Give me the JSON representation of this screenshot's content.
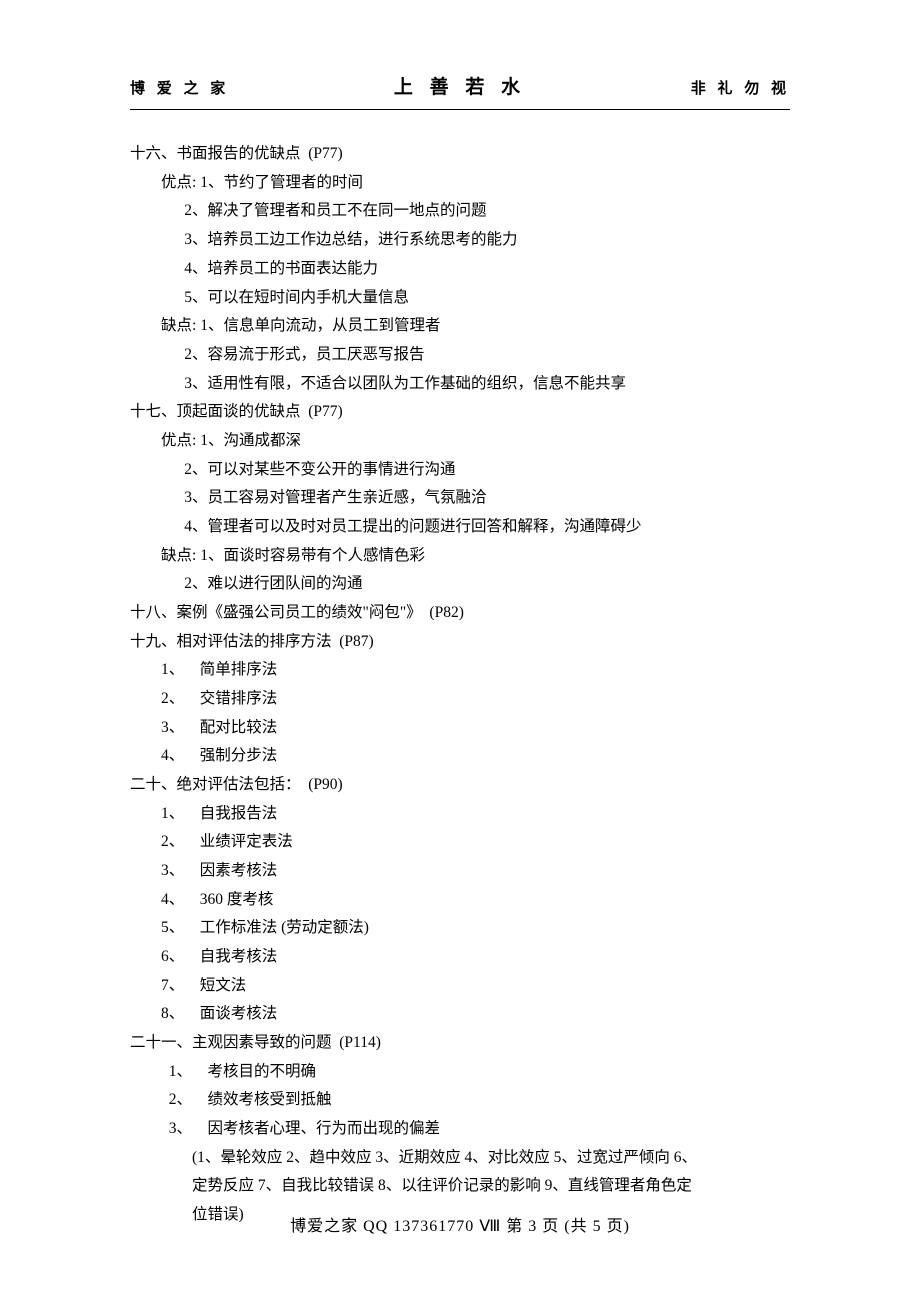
{
  "header": {
    "left": "博 爱 之 家",
    "center": "上 善 若 水",
    "right": "非 礼 勿 视"
  },
  "sections": {
    "s16": {
      "title": "十六、书面报告的优缺点  (P77)",
      "pros_label": "优点:",
      "pros": [
        "1、节约了管理者的时间",
        "2、解决了管理者和员工不在同一地点的问题",
        "3、培养员工边工作边总结，进行系统思考的能力",
        "4、培养员工的书面表达能力",
        "5、可以在短时间内手机大量信息"
      ],
      "cons_label": "缺点:",
      "cons": [
        "1、信息单向流动，从员工到管理者",
        "2、容易流于形式，员工厌恶写报告",
        "3、适用性有限，不适合以团队为工作基础的组织，信息不能共享"
      ]
    },
    "s17": {
      "title": "十七、顶起面谈的优缺点  (P77)",
      "pros_label": "优点:",
      "pros": [
        "1、沟通成都深",
        "2、可以对某些不变公开的事情进行沟通",
        "3、员工容易对管理者产生亲近感，气氛融洽",
        "4、管理者可以及时对员工提出的问题进行回答和解释，沟通障碍少"
      ],
      "cons_label": "缺点:",
      "cons": [
        "1、面谈时容易带有个人感情色彩",
        "2、难以进行团队间的沟通"
      ]
    },
    "s18": {
      "title": "十八、案例《盛强公司员工的绩效\"闷包\"》  (P82)"
    },
    "s19": {
      "title": "十九、相对评估法的排序方法  (P87)",
      "items": [
        "1、    简单排序法",
        "2、    交错排序法",
        "3、    配对比较法",
        "4、    强制分步法"
      ]
    },
    "s20": {
      "title": "二十、绝对评估法包括：  (P90)",
      "items": [
        "1、    自我报告法",
        "2、    业绩评定表法",
        "3、    因素考核法",
        "4、    360 度考核",
        "5、    工作标准法 (劳动定额法)",
        "6、    自我考核法",
        "7、    短文法",
        "8、    面谈考核法"
      ]
    },
    "s21": {
      "title": "二十一、主观因素导致的问题  (P114)",
      "items": [
        "1、    考核目的不明确",
        "2、    绩效考核受到抵触",
        "3、    因考核者心理、行为而出现的偏差"
      ],
      "sub": [
        "(1、晕轮效应 2、趋中效应 3、近期效应 4、对比效应 5、过宽过严倾向 6、",
        "定势反应 7、自我比较错误 8、以往评价记录的影响 9、直线管理者角色定",
        "位错误)"
      ]
    }
  },
  "footer": {
    "text": "博爱之家   QQ 137361770   Ⅷ   第 3 页 (共 5 页)"
  }
}
